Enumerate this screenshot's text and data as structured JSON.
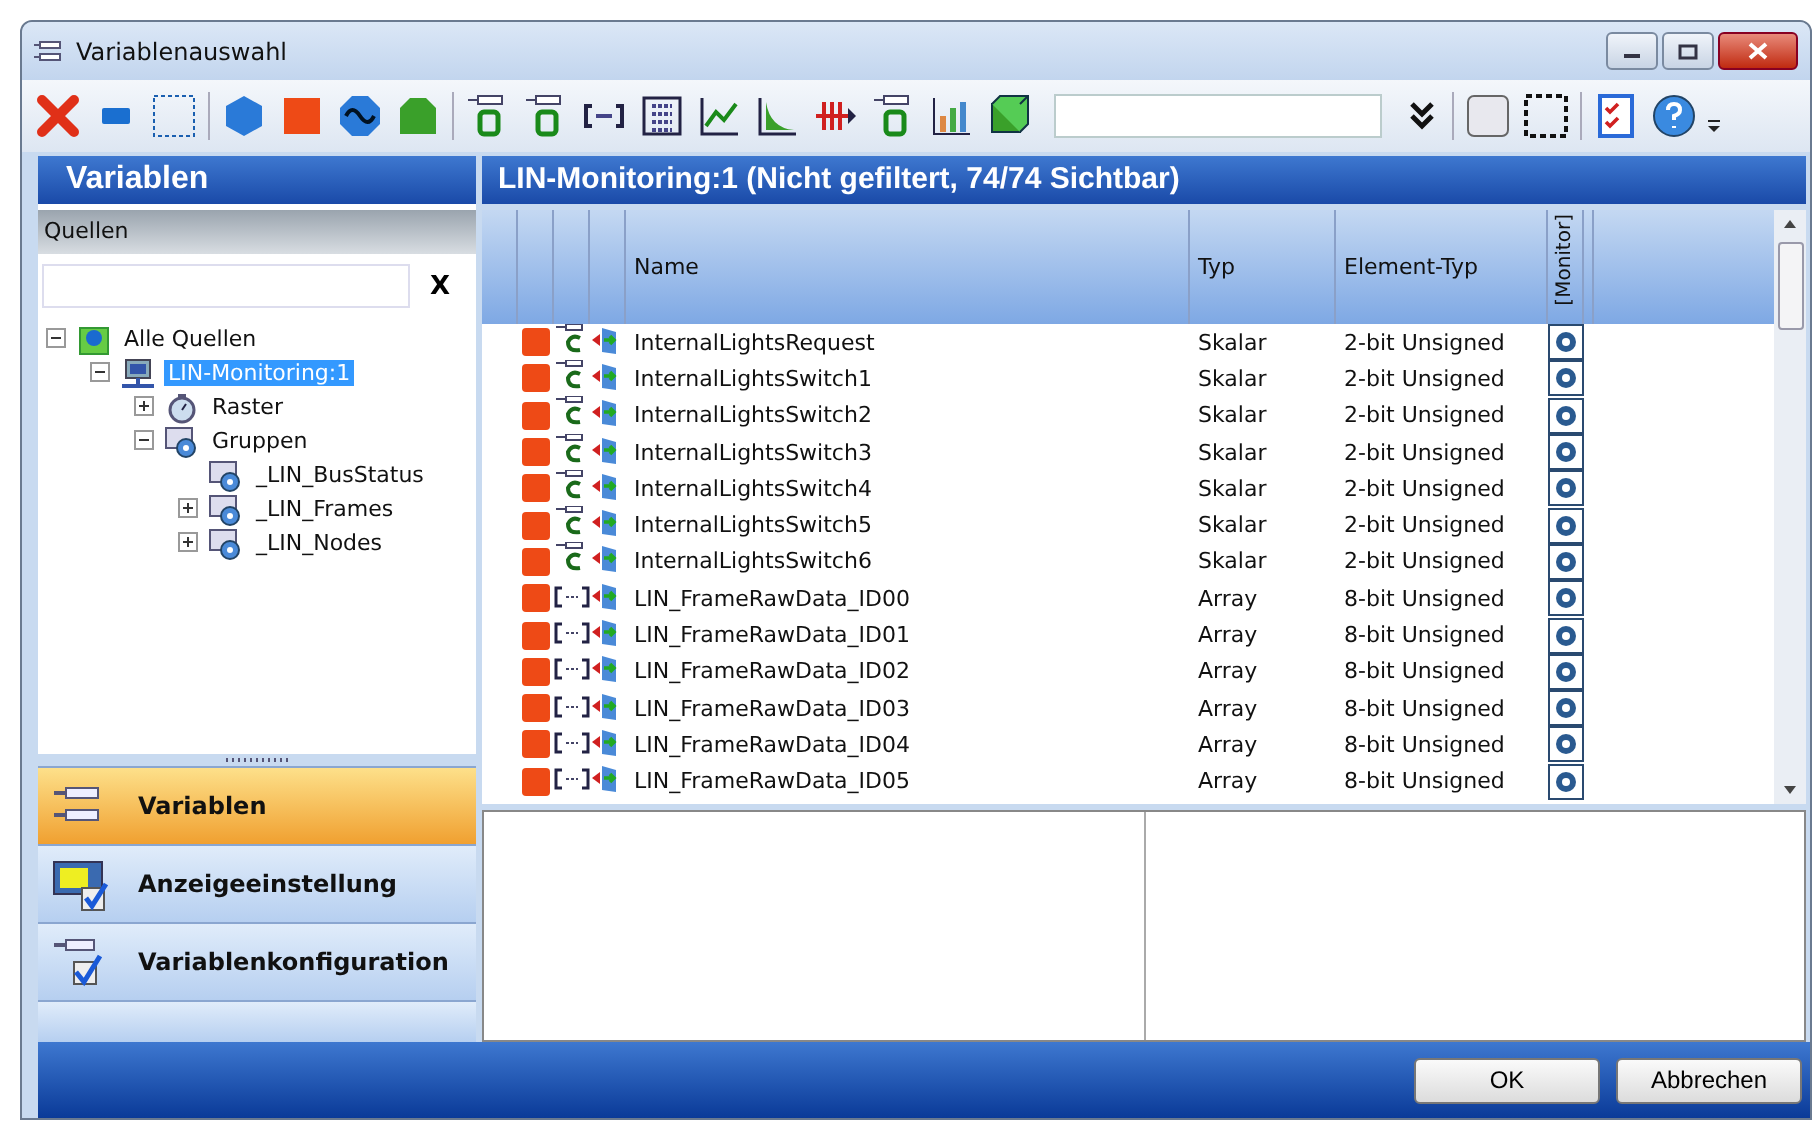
{
  "window": {
    "title": "Variablenauswahl"
  },
  "left_panel": {
    "title": "Variablen",
    "sources": {
      "label": "Quellen",
      "filter": {
        "clear": "X"
      },
      "tree": [
        {
          "label": "Alle Quellen",
          "kind": "root",
          "expanded": true,
          "selected": false,
          "children": [
            {
              "label": "LIN-Monitoring:1",
              "kind": "device",
              "expanded": true,
              "selected": true,
              "children": [
                {
                  "label": "Raster",
                  "kind": "raster",
                  "expanded": false,
                  "selected": false
                },
                {
                  "label": "Gruppen",
                  "kind": "group",
                  "expanded": true,
                  "selected": false,
                  "children": [
                    {
                      "label": "_LIN_BusStatus",
                      "kind": "group",
                      "selected": false
                    },
                    {
                      "label": "_LIN_Frames",
                      "kind": "group",
                      "expanded": false,
                      "selected": false
                    },
                    {
                      "label": "_LIN_Nodes",
                      "kind": "group",
                      "expanded": false,
                      "selected": false
                    }
                  ]
                }
              ]
            }
          ]
        }
      ]
    },
    "nav": [
      {
        "label": "Variablen",
        "selected": true
      },
      {
        "label": "Anzeigeeinstellung",
        "selected": false
      },
      {
        "label": "Variablenkonfiguration",
        "selected": false
      }
    ]
  },
  "grid": {
    "title": "LIN-Monitoring:1 (Nicht gefiltert, 74/74 Sichtbar)",
    "columns": [
      "Name",
      "Typ",
      "Element-Typ",
      "[Monitor]"
    ],
    "rows": [
      {
        "kind": "scalar",
        "name": "InternalLightsRequest",
        "type": "Skalar",
        "element_type": "2-bit Unsigned"
      },
      {
        "kind": "scalar",
        "name": "InternalLightsSwitch1",
        "type": "Skalar",
        "element_type": "2-bit Unsigned"
      },
      {
        "kind": "scalar",
        "name": "InternalLightsSwitch2",
        "type": "Skalar",
        "element_type": "2-bit Unsigned"
      },
      {
        "kind": "scalar",
        "name": "InternalLightsSwitch3",
        "type": "Skalar",
        "element_type": "2-bit Unsigned"
      },
      {
        "kind": "scalar",
        "name": "InternalLightsSwitch4",
        "type": "Skalar",
        "element_type": "2-bit Unsigned"
      },
      {
        "kind": "scalar",
        "name": "InternalLightsSwitch5",
        "type": "Skalar",
        "element_type": "2-bit Unsigned"
      },
      {
        "kind": "scalar",
        "name": "InternalLightsSwitch6",
        "type": "Skalar",
        "element_type": "2-bit Unsigned"
      },
      {
        "kind": "array",
        "name": "LIN_FrameRawData_ID00",
        "type": "Array",
        "element_type": "8-bit Unsigned"
      },
      {
        "kind": "array",
        "name": "LIN_FrameRawData_ID01",
        "type": "Array",
        "element_type": "8-bit Unsigned"
      },
      {
        "kind": "array",
        "name": "LIN_FrameRawData_ID02",
        "type": "Array",
        "element_type": "8-bit Unsigned"
      },
      {
        "kind": "array",
        "name": "LIN_FrameRawData_ID03",
        "type": "Array",
        "element_type": "8-bit Unsigned"
      },
      {
        "kind": "array",
        "name": "LIN_FrameRawData_ID04",
        "type": "Array",
        "element_type": "8-bit Unsigned"
      },
      {
        "kind": "array",
        "name": "LIN_FrameRawData_ID05",
        "type": "Array",
        "element_type": "8-bit Unsigned"
      }
    ]
  },
  "buttons": [
    "OK",
    "Abbrechen"
  ]
}
